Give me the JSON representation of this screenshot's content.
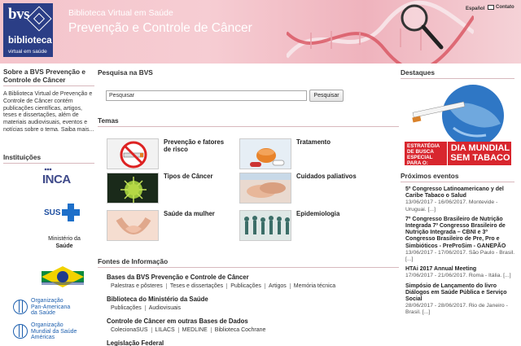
{
  "header": {
    "logo_text": "bvs",
    "logo_sub1": "biblioteca",
    "logo_sub2": "virtual em saúde",
    "title": "Biblioteca Virtual em Saúde",
    "subtitle": "Prevenção e Controle de Câncer",
    "lang": "Español",
    "contact": "Contato"
  },
  "sidebar": {
    "about_title": "Sobre a BVS Prevenção e Controle de Câncer",
    "about_text": "A Biblioteca Virtual de Prevenção e Controle de Câncer contém publicações científicas, artigos, teses e dissertações, além de materiais audiovisuais, eventos e notícias sobre o tema. Saiba mais...",
    "institutions_title": "Instituições",
    "inca": "INCA",
    "sus": "SUS",
    "ministerio_line1": "Ministério da",
    "ministerio_line2": "Saúde",
    "opas_line1": "Organização",
    "opas_line2": "Pan-Americana",
    "opas_line3": "da Saúde",
    "oms_line1": "Organização",
    "oms_line2": "Mundial da Saúde",
    "oms_line3": "Américas"
  },
  "search": {
    "title": "Pesquisa na BVS",
    "placeholder": "Pesquisar",
    "button": "Pesquisar"
  },
  "temas": {
    "title": "Temas",
    "items": [
      {
        "label": "Prevenção e fatores de risco"
      },
      {
        "label": "Tratamento"
      },
      {
        "label": "Tipos de Câncer"
      },
      {
        "label": "Cuidados paliativos"
      },
      {
        "label": "Saúde da mulher"
      },
      {
        "label": "Epidemiologia"
      }
    ]
  },
  "fontes": {
    "title": "Fontes de Informação",
    "sources": [
      {
        "title": "Bases da BVS Prevenção e Controle de Câncer",
        "links": [
          "Palestras e pôsteres",
          "Teses e dissertações",
          "Publicações",
          "Artigos",
          "Memória técnica"
        ]
      },
      {
        "title": "Biblioteca do Ministério da Saúde",
        "links": [
          "Publicações",
          "Audiovisuais"
        ]
      },
      {
        "title": "Controle de Câncer em outras Bases de Dados",
        "links": [
          "ColecionaSUS",
          "LILACS",
          "MEDLINE",
          "Biblioteca Cochrane"
        ]
      },
      {
        "title": "Legislação Federal",
        "links": []
      }
    ]
  },
  "destaques": {
    "title": "Destaques",
    "banner_left": "ESTRATÉGIA DE BUSCA ESPECIAL PARA O:",
    "banner_right1": "DIA MUNDIAL",
    "banner_right2": "SEM TABACO"
  },
  "events": {
    "title": "Próximos eventos",
    "items": [
      {
        "title": "5º Congresso Latinoamericano y del Caribe Tabaco o Salud",
        "date": "13/06/2017 - 16/06/2017. Montevide - Uruguai. [...]"
      },
      {
        "title": "7º Congresso Brasileiro de Nutrição Integrada 7º Congresso Brasileiro de Nutrição Integrada – CBNI e 3º Congresso Brasileiro de Pre, Pro e Simbióticos - PreProSim - GANEPÃO",
        "date": "13/06/2017 - 17/06/2017. São Paulo - Brasil. [...]"
      },
      {
        "title": "HTAi 2017 Annual Meeting",
        "date": "17/06/2017 - 21/06/2017. Roma - Itália. [...]"
      },
      {
        "title": "Simpósio de Lançamento do livro Diálogos em Saúde Pública e Serviço Social",
        "date": "28/06/2017 - 28/06/2017. Rio de Janeiro - Brasil. [...]"
      }
    ]
  },
  "colors": {
    "header_pink": "#f4c4cb",
    "logo_blue": "#2b3e86",
    "banner_red": "#d8262e",
    "rule": "#d8b8bd"
  }
}
